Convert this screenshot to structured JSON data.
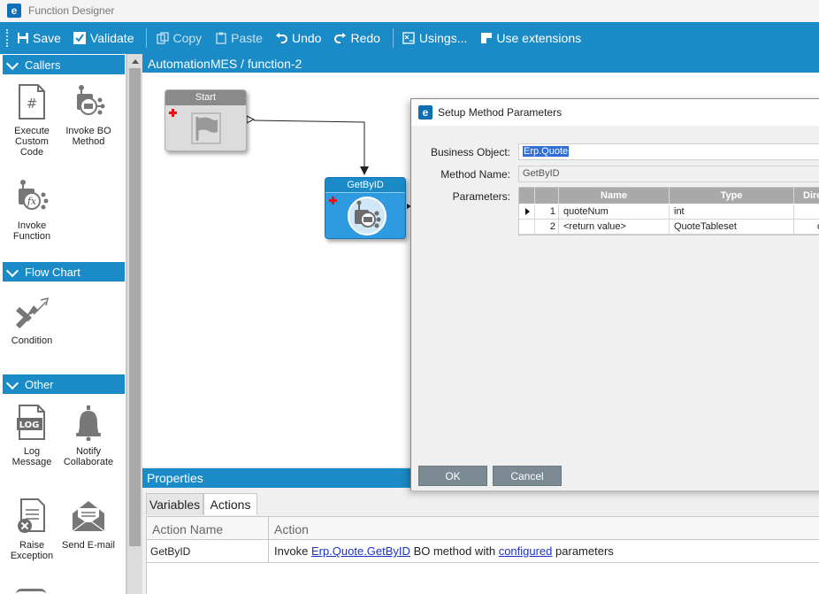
{
  "window": {
    "title": "Function Designer",
    "logo_letter": "e"
  },
  "toolbar": {
    "save": "Save",
    "validate": "Validate",
    "copy": "Copy",
    "paste": "Paste",
    "undo": "Undo",
    "redo": "Redo",
    "usings": "Usings...",
    "use_extensions": "Use extensions"
  },
  "toolbox": {
    "callers": {
      "title": "Callers",
      "items": [
        "Execute Custom Code",
        "Invoke BO Method",
        "Invoke Function"
      ]
    },
    "flow_chart": {
      "title": "Flow Chart",
      "items": [
        "Condition"
      ]
    },
    "other": {
      "title": "Other",
      "items": [
        "Log Message",
        "Notify Collaborate",
        "Raise Exception",
        "Send E-mail"
      ],
      "log_icon_text": "LOG"
    }
  },
  "canvas": {
    "breadcrumb": "AutomationMES / function-2",
    "nodes": {
      "start": "Start",
      "getbyid": "GetByID"
    }
  },
  "properties": {
    "title": "Properties",
    "tabs": [
      "Variables",
      "Actions"
    ],
    "active_tab": "Actions",
    "columns": [
      "Action Name",
      "Action"
    ],
    "row": {
      "name": "GetByID",
      "action_prefix": "Invoke",
      "action_link1": "Erp.Quote.GetByID",
      "action_mid": "BO method with",
      "action_link2": "configured",
      "action_suffix": "parameters"
    }
  },
  "dialog": {
    "title": "Setup Method Parameters",
    "business_object_label": "Business Object:",
    "business_object_value": "Erp.Quote",
    "method_name_label": "Method Name:",
    "method_name_value": "GetByID",
    "parameters_label": "Parameters:",
    "param_columns": [
      "Name",
      "Type",
      "Dire"
    ],
    "params": [
      {
        "index": "1",
        "name": "quoteNum",
        "type": "int",
        "dir": ""
      },
      {
        "index": "2",
        "name": "<return value>",
        "type": "QuoteTableset",
        "dir": "o"
      }
    ],
    "ok": "OK",
    "cancel": "Cancel"
  },
  "colors": {
    "accent": "#1a8bc7",
    "node_blue": "#2e9be0",
    "link": "#1a32c8",
    "selection": "#2f6fd4"
  }
}
